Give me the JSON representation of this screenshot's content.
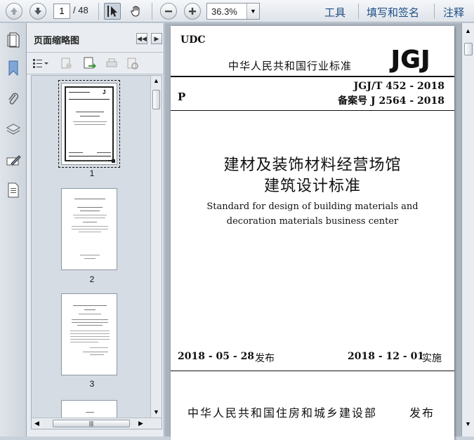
{
  "toolbar": {
    "current_page": "1",
    "total_pages": "/ 48",
    "zoom": "36.3%",
    "menu_tools": "工具",
    "menu_fill_sign": "填写和签名",
    "menu_comment": "注释"
  },
  "sidebar": {
    "panel_title": "页面缩略图",
    "thumbnails": [
      {
        "label": "1"
      },
      {
        "label": "2"
      },
      {
        "label": "3"
      }
    ]
  },
  "document": {
    "udc": "UDC",
    "p_code": "P",
    "standard_header": "中华人民共和国行业标准",
    "logo": "JGJ",
    "standard_number": "JGJ/T 452 - 2018",
    "record_number": "备案号 J 2564 - 2018",
    "title_line1": "建材及装饰材料经营场馆",
    "title_line2": "建筑设计标准",
    "english_line1": "Standard for design of building materials and",
    "english_line2": "decoration materials business center",
    "issue_date": "2018 - 05 - 28",
    "issue_label": "发布",
    "effective_date": "2018 - 12 - 01",
    "effective_label": "实施",
    "publisher": "中华人民共和国住房和城乡建设部",
    "publisher_label": "发布"
  }
}
